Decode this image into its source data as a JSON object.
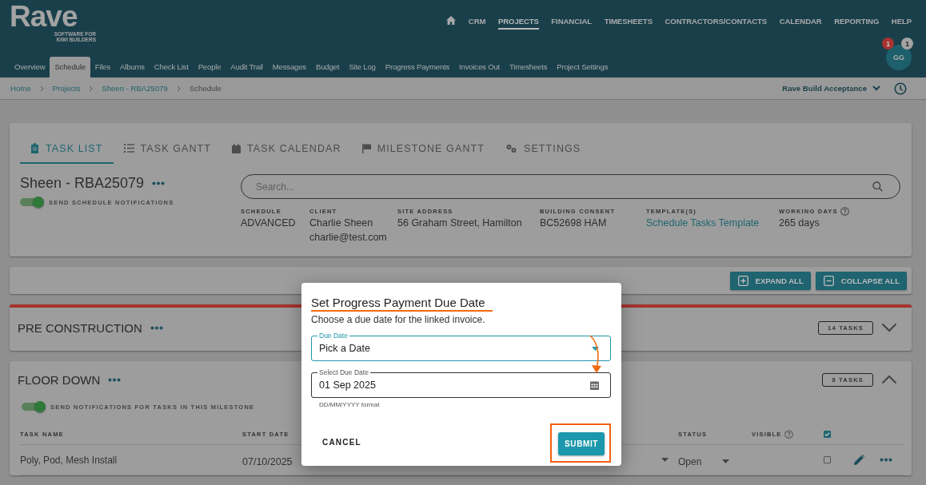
{
  "top_nav": {
    "logo": "Rave",
    "tagline": [
      "SOFTWARE FOR",
      "KIWI BUILDERS"
    ],
    "items": [
      {
        "label": "CRM",
        "selected": false
      },
      {
        "label": "PROJECTS",
        "selected": true
      },
      {
        "label": "FINANCIAL",
        "selected": false
      },
      {
        "label": "TIMESHEETS",
        "selected": false
      },
      {
        "label": "CONTRACTORS/CONTACTS",
        "selected": false
      },
      {
        "label": "CALENDAR",
        "selected": false
      },
      {
        "label": "REPORTING",
        "selected": false
      },
      {
        "label": "HELP",
        "selected": false
      }
    ]
  },
  "avatar": {
    "initials": "GG",
    "badges": [
      {
        "count": "1",
        "color": "#a8332f"
      },
      {
        "count": "1",
        "color": "#a3a3a3"
      }
    ]
  },
  "project_tabs": [
    {
      "label": "Overview",
      "selected": false
    },
    {
      "label": "Schedule",
      "selected": true
    },
    {
      "label": "Files",
      "selected": false
    },
    {
      "label": "Albums",
      "selected": false
    },
    {
      "label": "Check List",
      "selected": false
    },
    {
      "label": "People",
      "selected": false
    },
    {
      "label": "Audit Trail",
      "selected": false
    },
    {
      "label": "Messages",
      "selected": false
    },
    {
      "label": "Budget",
      "selected": false
    },
    {
      "label": "Site Log",
      "selected": false
    },
    {
      "label": "Progress Payments",
      "selected": false
    },
    {
      "label": "Invoices Out",
      "selected": false
    },
    {
      "label": "Timesheets",
      "selected": false
    },
    {
      "label": "Project Settings",
      "selected": false
    }
  ],
  "breadcrumbs": [
    {
      "label": "Home",
      "current": false
    },
    {
      "label": "Projects",
      "current": false
    },
    {
      "label": "Sheen - RBA25079",
      "current": false
    },
    {
      "label": "Schedule",
      "current": true
    }
  ],
  "workspace": "Rave Build Acceptance",
  "view_tabs": [
    {
      "label": "TASK LIST",
      "selected": true
    },
    {
      "label": "TASK GANTT",
      "selected": false
    },
    {
      "label": "TASK CALENDAR",
      "selected": false
    },
    {
      "label": "MILESTONE GANTT",
      "selected": false
    },
    {
      "label": "SETTINGS",
      "selected": false
    }
  ],
  "project": {
    "title": "Sheen - RBA25079",
    "notifications": {
      "label": "SEND SCHEDULE NOTIFICATIONS",
      "on": true
    },
    "search": {
      "placeholder": "Search..."
    },
    "details": [
      {
        "label": "SCHEDULE",
        "values": [
          "ADVANCED"
        ],
        "kind": "text",
        "help": false
      },
      {
        "label": "CLIENT",
        "values": [
          "Charlie Sheen",
          "charlie@test.com"
        ],
        "kind": "text",
        "help": false
      },
      {
        "label": "SITE ADDRESS",
        "values": [
          "56 Graham Street, Hamilton"
        ],
        "kind": "text",
        "help": false
      },
      {
        "label": "BUILDING CONSENT",
        "values": [
          "BC52698 HAM"
        ],
        "kind": "text",
        "help": false
      },
      {
        "label": "TEMPLATE(S)",
        "values": [
          "Schedule Tasks Template"
        ],
        "kind": "link",
        "help": false
      },
      {
        "label": "WORKING DAYS",
        "values": [
          "265 days"
        ],
        "kind": "text",
        "help": true
      }
    ]
  },
  "toolbar_buttons": [
    {
      "label": "EXPAND ALL",
      "kind": "expand"
    },
    {
      "label": "COLLAPSE ALL",
      "kind": "collapse"
    }
  ],
  "milestones": [
    {
      "title": "PRE CONSTRUCTION",
      "task_count": "14 TASKS",
      "flagged": true,
      "expanded": false
    },
    {
      "title": "FLOOR DOWN",
      "task_count": "8 TASKS",
      "flagged": false,
      "expanded": true,
      "notifications": {
        "label": "SEND NOTIFICATIONS FOR TASKS IN THIS MILESTONE",
        "on": true
      },
      "columns": [
        {
          "label": "TASK NAME",
          "help": false
        },
        {
          "label": "START DATE",
          "help": false
        },
        {
          "label": "STATUS",
          "help": false
        },
        {
          "label": "VISIBLE",
          "help": true
        }
      ],
      "select_all": true,
      "rows": [
        {
          "name": "Poly, Pod, Mesh Install",
          "start_date": "07/10/2025",
          "status": "Open",
          "visible": false
        }
      ]
    }
  ],
  "dialog": {
    "title": "Set Progress Payment Due Date",
    "title_underlined": true,
    "subtitle": "Choose a due date for the linked invoice.",
    "fields": [
      {
        "kind": "select",
        "label": "Due Date",
        "value": "Pick a Date",
        "focused": true,
        "pointed": false
      },
      {
        "kind": "date",
        "label": "Select Due Date",
        "value": "01 Sep 2025",
        "hint": "DD/MM/YYYY format",
        "focused": false,
        "pointed": true
      }
    ],
    "buttons": [
      {
        "label": "CANCEL",
        "kind": "text",
        "highlighted": false
      },
      {
        "label": "SUBMIT",
        "kind": "primary",
        "highlighted": true
      }
    ]
  }
}
